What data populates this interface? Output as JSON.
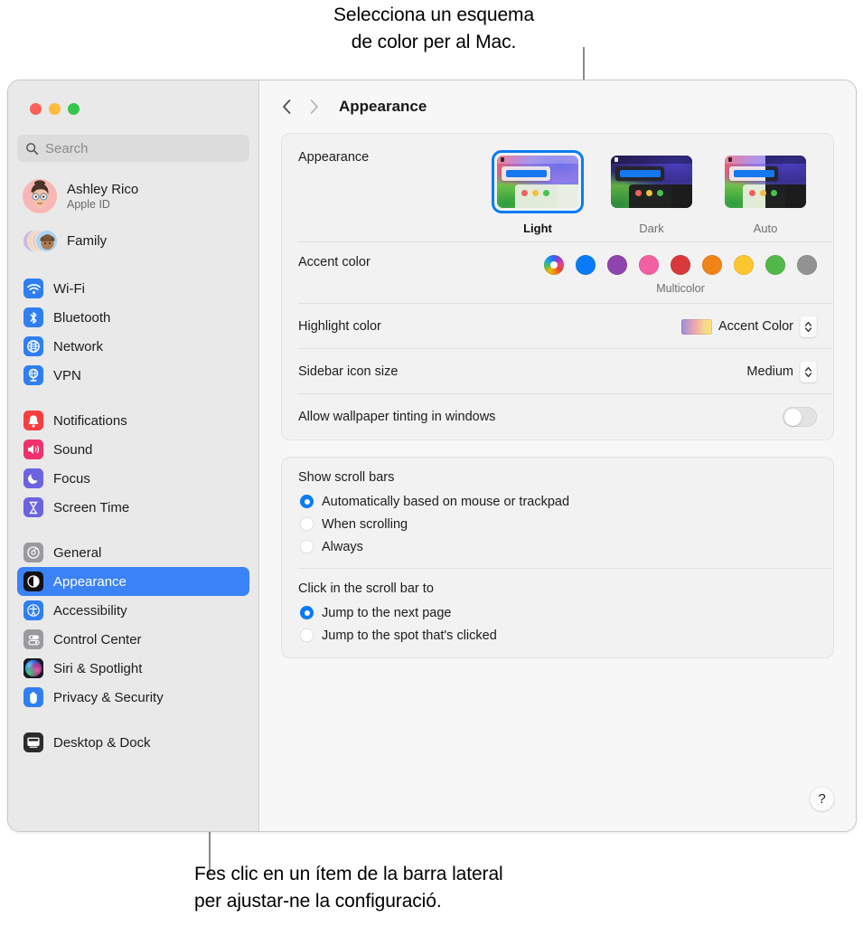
{
  "callouts": {
    "top_line1": "Selecciona un esquema",
    "top_line2": "de color per al Mac.",
    "bottom_line1": "Fes clic en un ítem de la barra lateral",
    "bottom_line2": "per ajustar-ne la configuració."
  },
  "window": {
    "traffic_lights": [
      "close",
      "minimize",
      "zoom"
    ]
  },
  "sidebar": {
    "search": {
      "placeholder": "Search"
    },
    "account": {
      "name": "Ashley Rico",
      "subtitle": "Apple ID"
    },
    "family": {
      "label": "Family"
    },
    "groups": [
      {
        "items": [
          {
            "label": "Wi-Fi",
            "icon": "wifi-icon",
            "color": "#2f7ff0"
          },
          {
            "label": "Bluetooth",
            "icon": "bluetooth-icon",
            "color": "#2f7ff0"
          },
          {
            "label": "Network",
            "icon": "globe-icon",
            "color": "#2f7ff0"
          },
          {
            "label": "VPN",
            "icon": "vpn-icon",
            "color": "#2f7ff0"
          }
        ]
      },
      {
        "items": [
          {
            "label": "Notifications",
            "icon": "bell-icon",
            "color": "#f63e3e"
          },
          {
            "label": "Sound",
            "icon": "speaker-icon",
            "color": "#f0316b"
          },
          {
            "label": "Focus",
            "icon": "moon-icon",
            "color": "#6b63e0"
          },
          {
            "label": "Screen Time",
            "icon": "hourglass-icon",
            "color": "#6b63e0"
          }
        ]
      },
      {
        "items": [
          {
            "label": "General",
            "icon": "gear-icon",
            "color": "#9a9a9e"
          },
          {
            "label": "Appearance",
            "icon": "appearance-icon",
            "color": "#111114",
            "selected": true
          },
          {
            "label": "Accessibility",
            "icon": "accessibility-icon",
            "color": "#2f7ff0"
          },
          {
            "label": "Control Center",
            "icon": "control-center-icon",
            "color": "#9a9a9e"
          },
          {
            "label": "Siri & Spotlight",
            "icon": "siri-icon",
            "color": "#2b2b34"
          },
          {
            "label": "Privacy & Security",
            "icon": "hand-icon",
            "color": "#2f7ff0"
          }
        ]
      },
      {
        "items": [
          {
            "label": "Desktop & Dock",
            "icon": "desktop-icon",
            "color": "#2b2b2e",
            "clipped": true
          }
        ]
      }
    ],
    "selected_accent": "#3b82f6"
  },
  "toolbar": {
    "back": "‹",
    "forward": "›",
    "title": "Appearance"
  },
  "settings": {
    "appearance": {
      "label": "Appearance",
      "options": [
        {
          "name": "Light",
          "selected": true
        },
        {
          "name": "Dark",
          "selected": false
        },
        {
          "name": "Auto",
          "selected": false
        }
      ]
    },
    "accent_color": {
      "label": "Accent color",
      "caption": "Multicolor",
      "swatches": [
        {
          "name": "Multicolor",
          "color": "multicolor",
          "selected": true
        },
        {
          "name": "Blue",
          "color": "#0a7bf6"
        },
        {
          "name": "Purple",
          "color": "#8e44ad"
        },
        {
          "name": "Pink",
          "color": "#f35fa3"
        },
        {
          "name": "Red",
          "color": "#d8383a"
        },
        {
          "name": "Orange",
          "color": "#f08418"
        },
        {
          "name": "Yellow",
          "color": "#fbc62f"
        },
        {
          "name": "Green",
          "color": "#52b849"
        },
        {
          "name": "Graphite",
          "color": "#929292"
        }
      ]
    },
    "highlight_color": {
      "label": "Highlight color",
      "value": "Accent Color"
    },
    "sidebar_icon_size": {
      "label": "Sidebar icon size",
      "value": "Medium"
    },
    "wallpaper_tinting": {
      "label": "Allow wallpaper tinting in windows",
      "value": "off"
    },
    "show_scroll_bars": {
      "label": "Show scroll bars",
      "options": [
        {
          "label": "Automatically based on mouse or trackpad",
          "selected": true
        },
        {
          "label": "When scrolling",
          "selected": false
        },
        {
          "label": "Always",
          "selected": false
        }
      ]
    },
    "click_scroll_bar": {
      "label": "Click in the scroll bar to",
      "options": [
        {
          "label": "Jump to the next page",
          "selected": true
        },
        {
          "label": "Jump to the spot that's clicked",
          "selected": false
        }
      ]
    },
    "help": {
      "label": "?"
    }
  }
}
